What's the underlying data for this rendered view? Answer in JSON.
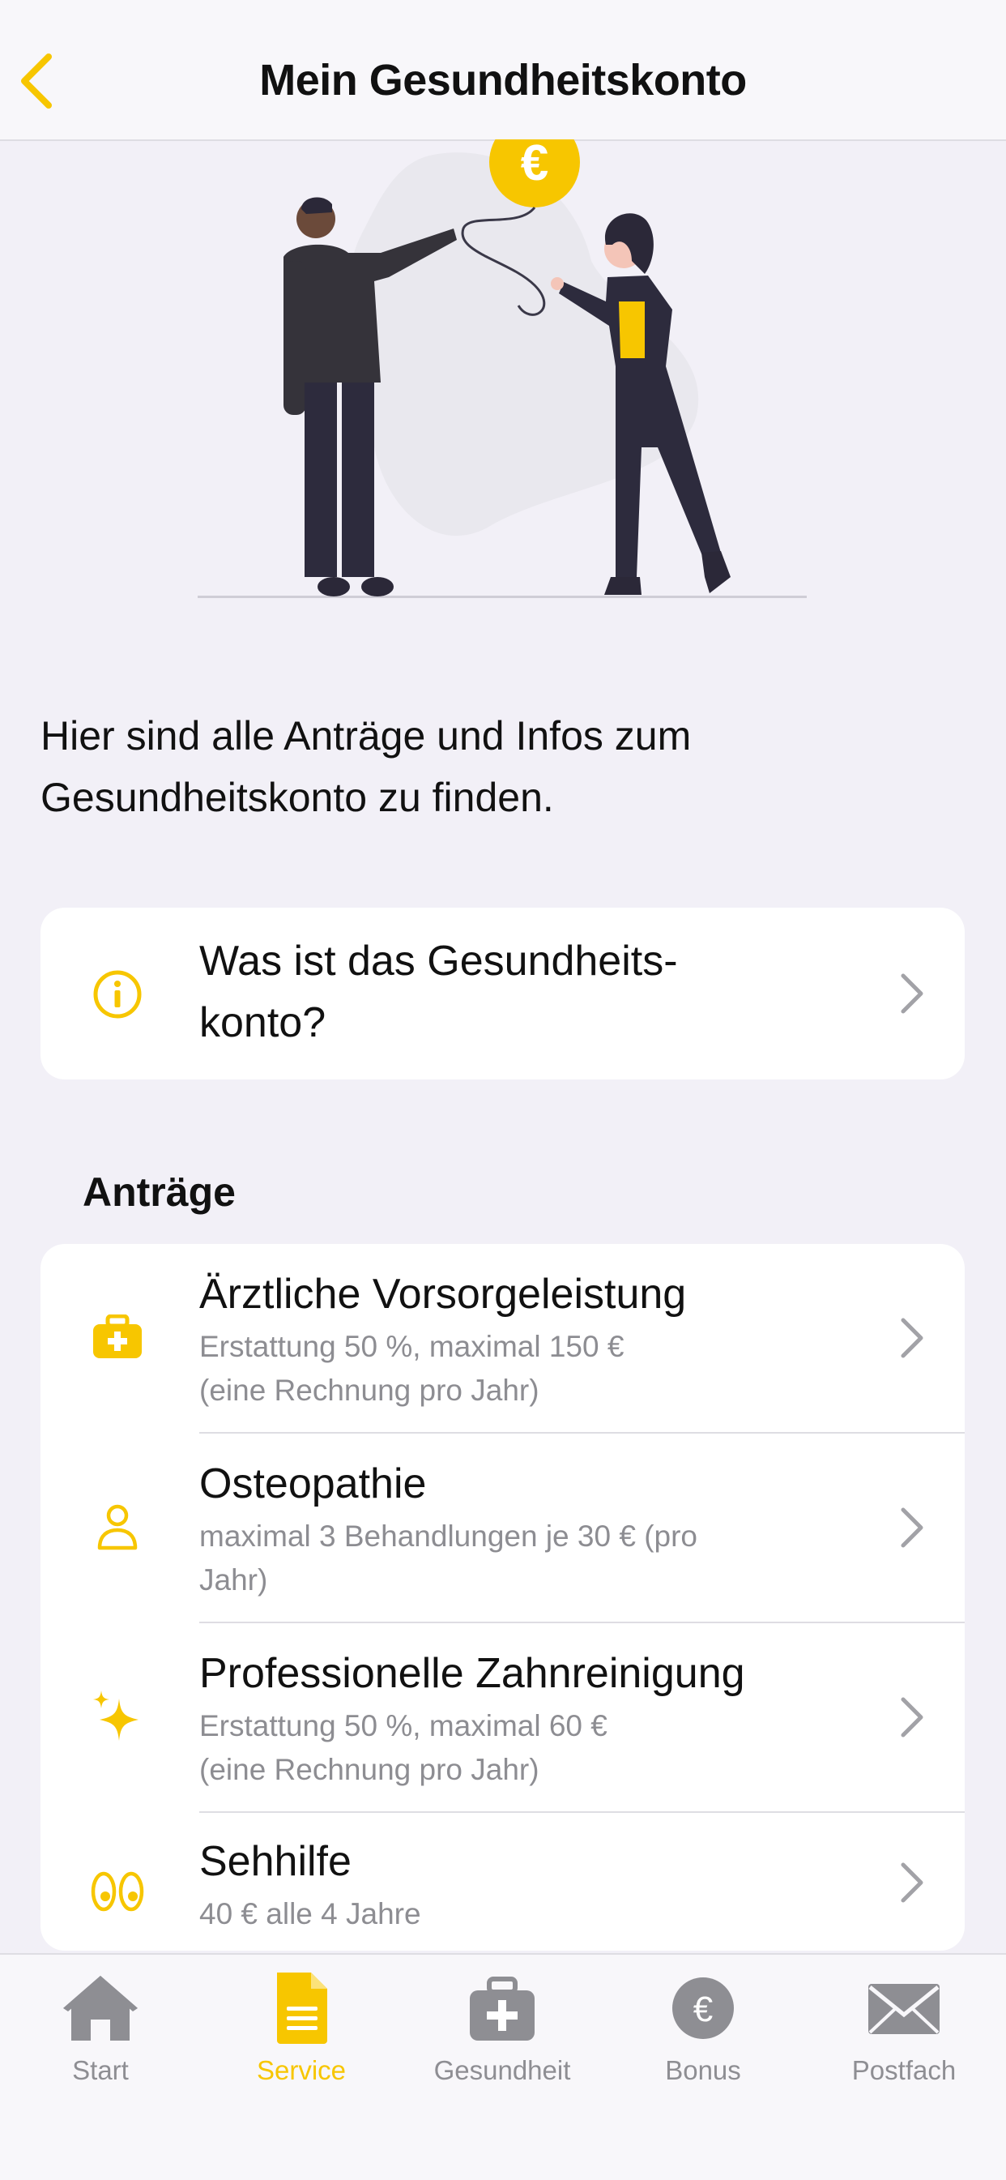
{
  "navbar": {
    "title": "Mein Gesundheitskonto",
    "back_icon": "chevron-left-icon"
  },
  "intro": {
    "text": "Hier sind alle Anträge und Infos zum Gesundheitskonto zu finden."
  },
  "info_card": {
    "icon": "info-circle-icon",
    "line1": "Was ist das Gesundheits-",
    "line2": "konto?"
  },
  "section": {
    "title": "Anträge"
  },
  "applications": [
    {
      "icon": "medical-case-icon",
      "title": "Ärztliche Vorsorgeleistung",
      "sub1": "Erstattung 50 %, maximal 150 €",
      "sub2": "(eine Rechnung pro Jahr)"
    },
    {
      "icon": "person-icon",
      "title": "Osteopathie",
      "sub1": "maximal 3 Behandlungen je 30 € (pro",
      "sub2": "Jahr)"
    },
    {
      "icon": "sparkles-icon",
      "title": "Professionelle Zahnreinigung",
      "sub1": "Erstattung 50 %, maximal 60 €",
      "sub2": "(eine Rechnung pro Jahr)"
    },
    {
      "icon": "eyes-icon",
      "title": "Sehhilfe",
      "sub1": "40 € alle 4 Jahre",
      "sub2": ""
    }
  ],
  "tabbar": {
    "active": "Service",
    "tabs": [
      {
        "label": "Start",
        "icon": "house-icon"
      },
      {
        "label": "Service",
        "icon": "document-icon"
      },
      {
        "label": "Gesundheit",
        "icon": "medical-case-icon"
      },
      {
        "label": "Bonus",
        "icon": "euro-coin-icon"
      },
      {
        "label": "Postfach",
        "icon": "envelope-icon"
      }
    ]
  },
  "colors": {
    "accent": "#f7c600",
    "background": "#f2f0f7",
    "secondary_text": "#8d8d92",
    "inactive_tab": "#8e8e93"
  }
}
